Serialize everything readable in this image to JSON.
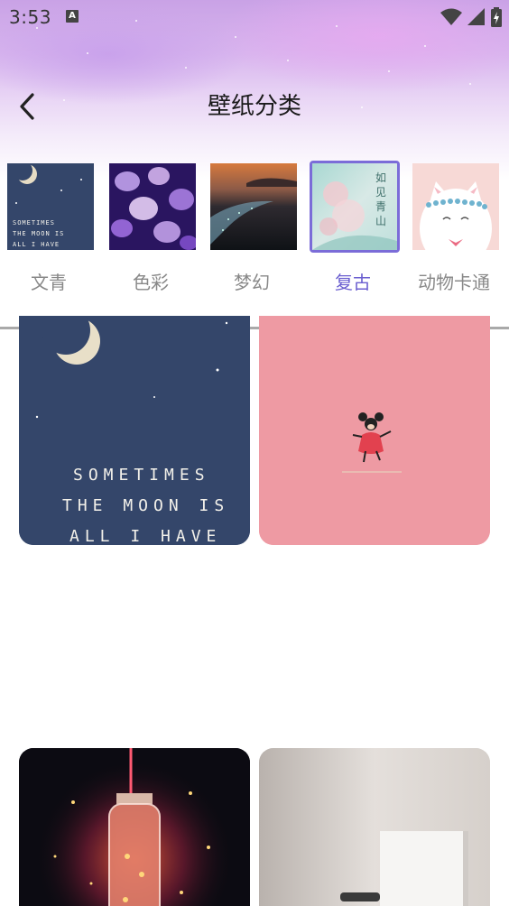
{
  "status_bar": {
    "time": "3:53",
    "icons": [
      "a-notification-icon",
      "wifi-icon",
      "signal-icon",
      "battery-charging-icon"
    ]
  },
  "nav": {
    "title": "壁纸分类",
    "back_icon": "chevron-left-icon"
  },
  "categories": [
    {
      "label": "文青",
      "selected": false
    },
    {
      "label": "色彩",
      "selected": false
    },
    {
      "label": "梦幻",
      "selected": false
    },
    {
      "label": "复古",
      "selected": true
    },
    {
      "label": "动物卡通",
      "selected": false
    }
  ],
  "thumb_text": {
    "moon_line1": "SOMETIMES",
    "moon_line2": "THE MOON IS",
    "moon_line3": "ALL I HAVE",
    "retro_text": "如见青山"
  },
  "colors": {
    "accent": "#6b5fd0",
    "label_default": "#888888",
    "divider": "#a9a9a9"
  }
}
